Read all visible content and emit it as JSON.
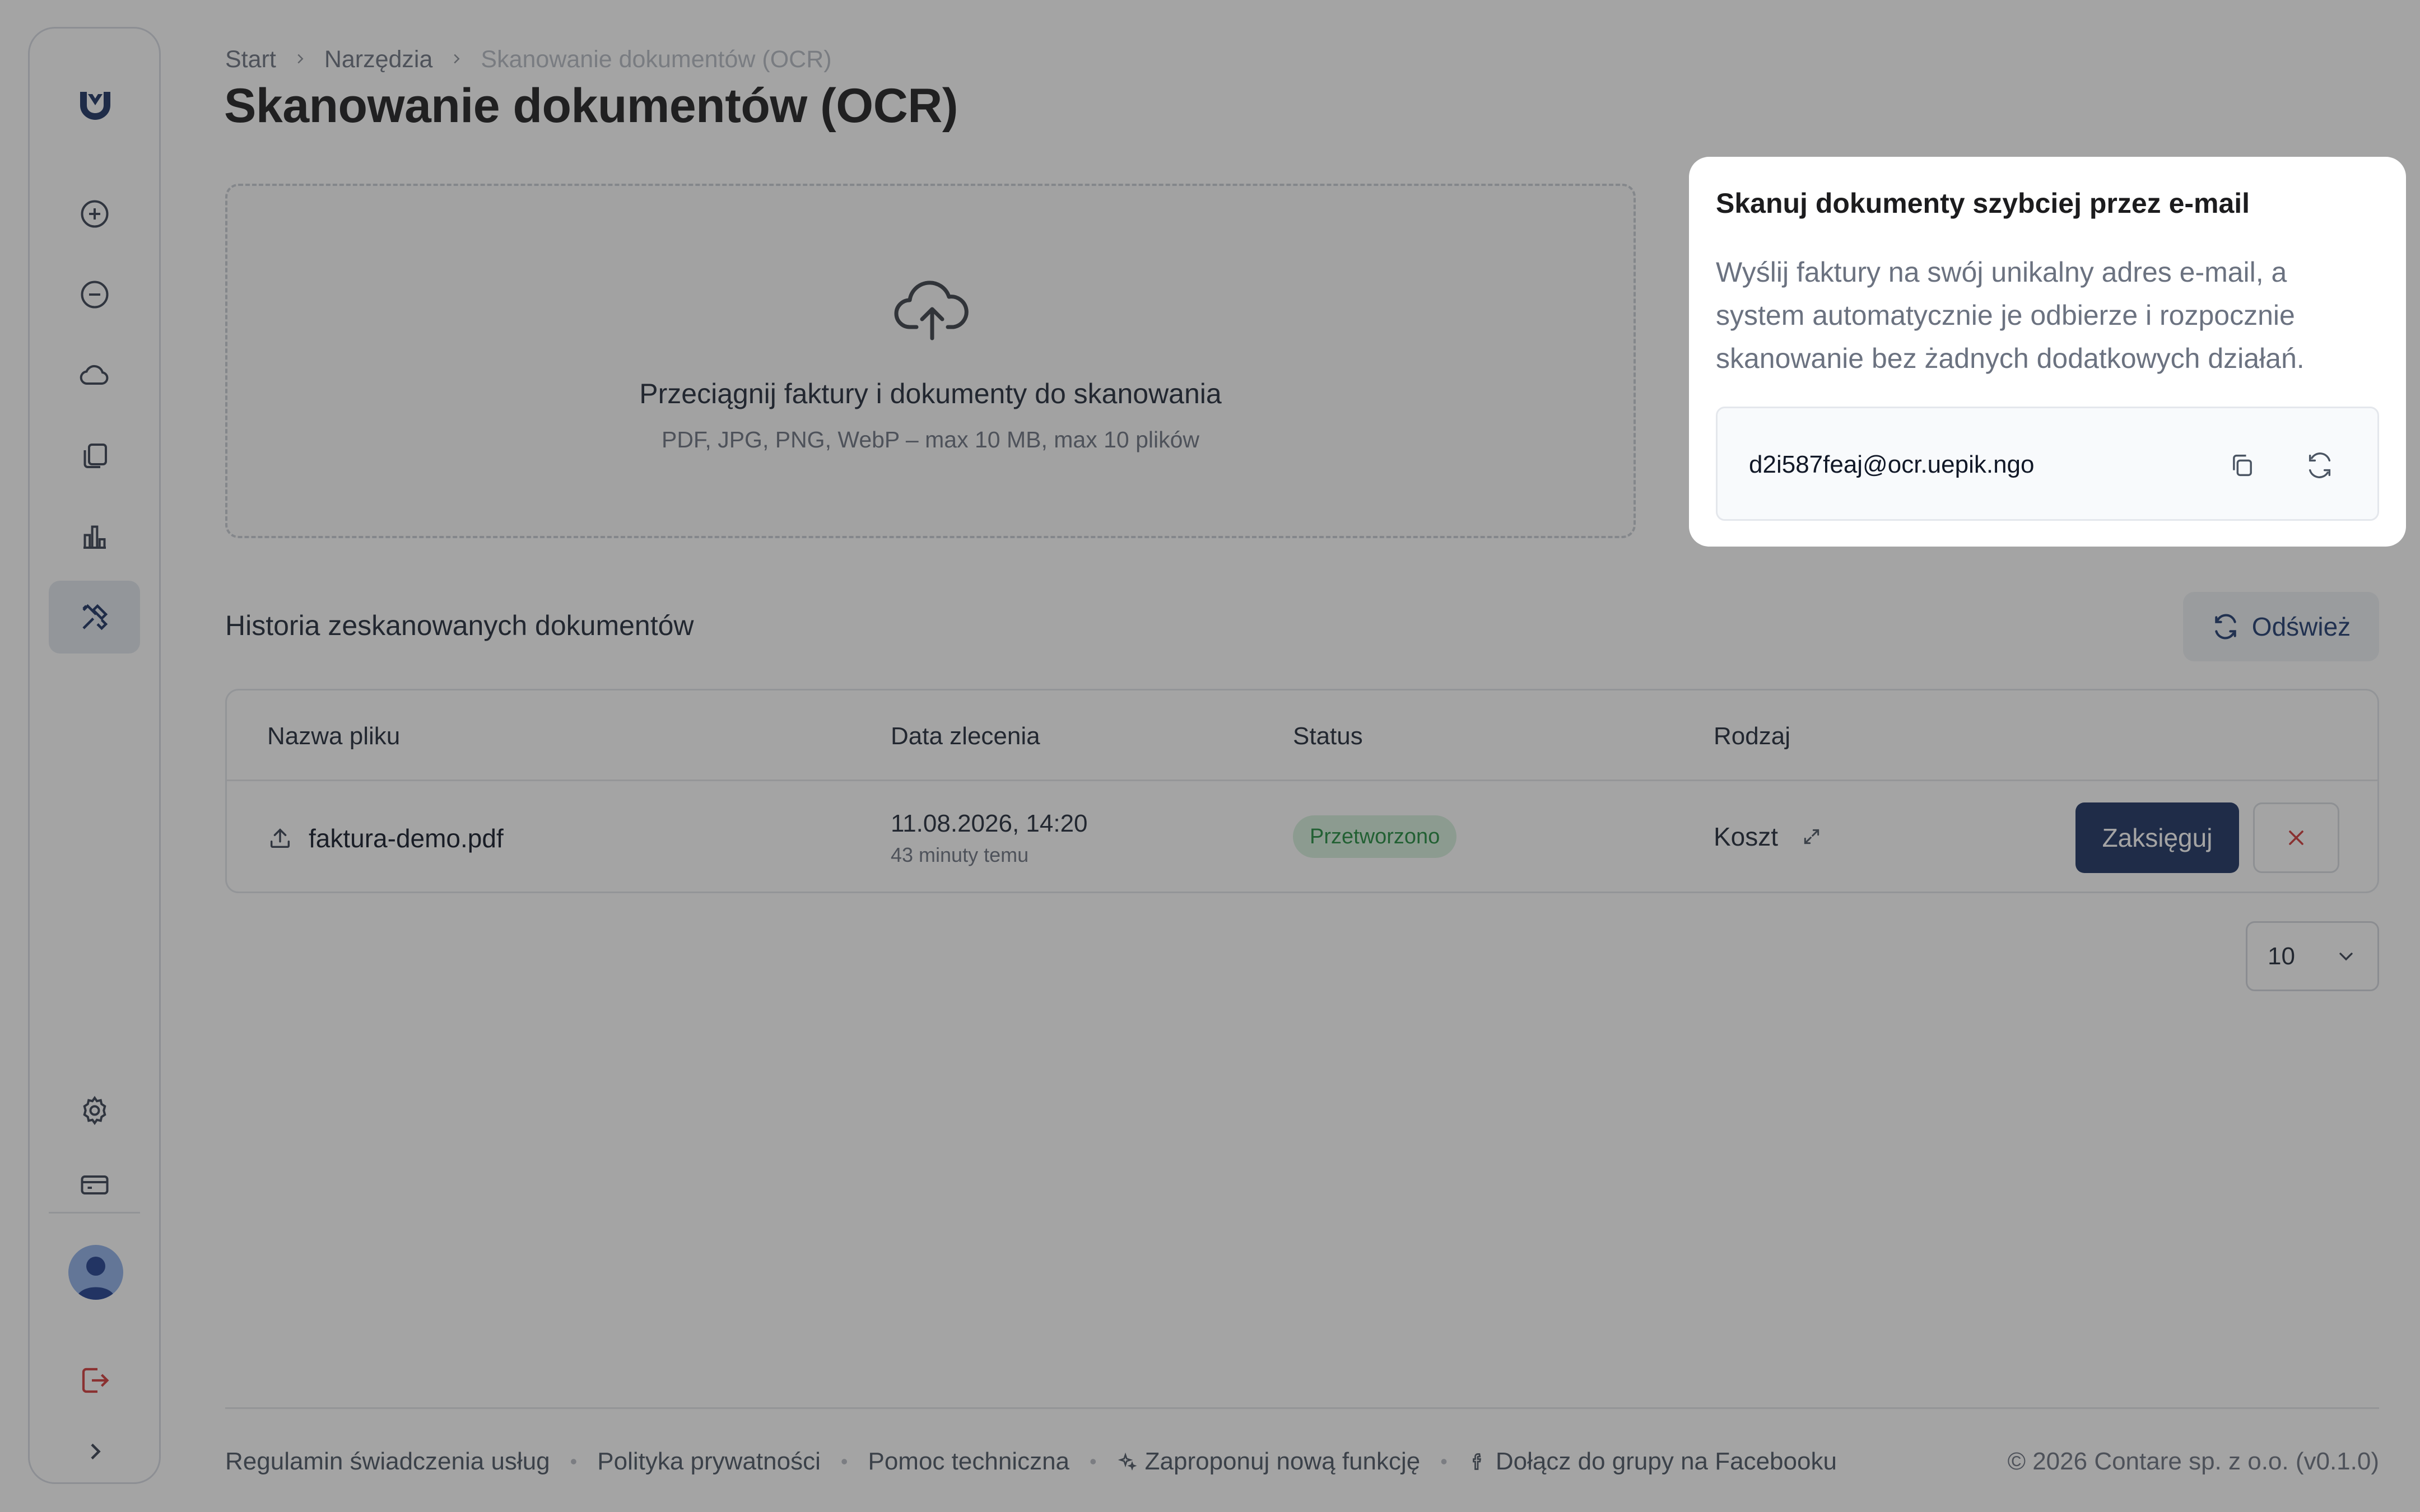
{
  "breadcrumb": {
    "items": [
      "Start",
      "Narzędzia",
      "Skanowanie dokumentów (OCR)"
    ]
  },
  "page": {
    "title": "Skanowanie dokumentów (OCR)"
  },
  "dropzone": {
    "title": "Przeciągnij faktury i dokumenty do skanowania",
    "subtitle": "PDF, JPG, PNG, WebP – max 10 MB, max 10 plików"
  },
  "history": {
    "title": "Historia zeskanowanych dokumentów",
    "refresh_label": "Odśwież",
    "columns": [
      "Nazwa pliku",
      "Data zlecenia",
      "Status",
      "Rodzaj"
    ],
    "rows": [
      {
        "file": "faktura-demo.pdf",
        "date": "11.08.2026, 14:20",
        "date_relative": "43 minuty temu",
        "status": "Przetworzono",
        "kind": "Koszt",
        "book_label": "Zaksięguj"
      }
    ],
    "page_size": "10"
  },
  "email_card": {
    "title": "Skanuj dokumenty szybciej przez e-mail",
    "text": "Wyślij faktury na swój unikalny adres e-mail, a system automatycznie je odbierze i rozpocznie skanowanie bez żadnych dodatkowych działań.",
    "email": "d2i587feaj@ocr.uepik.ngo"
  },
  "footer": {
    "links": [
      "Regulamin świadczenia usług",
      "Polityka prywatności",
      "Pomoc techniczna",
      "Zaproponuj nową funkcję",
      "Dołącz do grupy na Facebooku"
    ],
    "copyright": "© 2026 Contare sp. z o.o. (v0.1.0)"
  },
  "sidebar": {
    "items": [
      "plus-circle-icon",
      "minus-circle-icon",
      "cloud-icon",
      "documents-icon",
      "chart-icon",
      "tools-icon",
      "settings-icon",
      "card-icon",
      "logout-icon",
      "expand-icon"
    ],
    "active": "tools-icon"
  },
  "colors": {
    "brand": "#1b3161",
    "success_bg": "#d6f0dc",
    "success_text": "#1f8a3d",
    "danger": "#d33a3a",
    "overlay": "rgba(38,38,38,0.42)"
  }
}
